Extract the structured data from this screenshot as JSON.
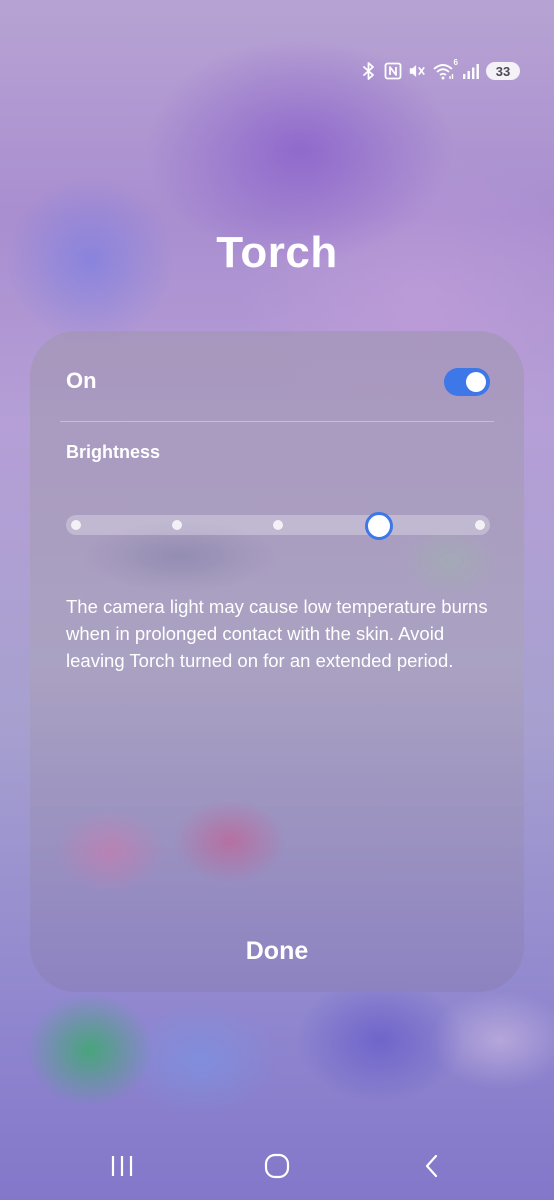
{
  "status_bar": {
    "icons": [
      "bluetooth-icon",
      "nfc-icon",
      "mute-icon",
      "wifi-icon",
      "signal-icon"
    ],
    "wifi_badge": "6",
    "battery_level": "33"
  },
  "title": "Torch",
  "panel": {
    "toggle_label": "On",
    "toggle_on": true,
    "brightness_label": "Brightness",
    "brightness": {
      "steps": 5,
      "value": 4
    },
    "warning": "The camera light may cause low temperature burns when in prolonged contact with the skin. Avoid leaving Torch turned on for an extended period.",
    "done_label": "Done"
  },
  "nav_bar": {
    "buttons": [
      "recent-apps-icon",
      "home-icon",
      "back-icon"
    ]
  },
  "colors": {
    "accent": "#3d77e8",
    "text": "#ffffff"
  }
}
